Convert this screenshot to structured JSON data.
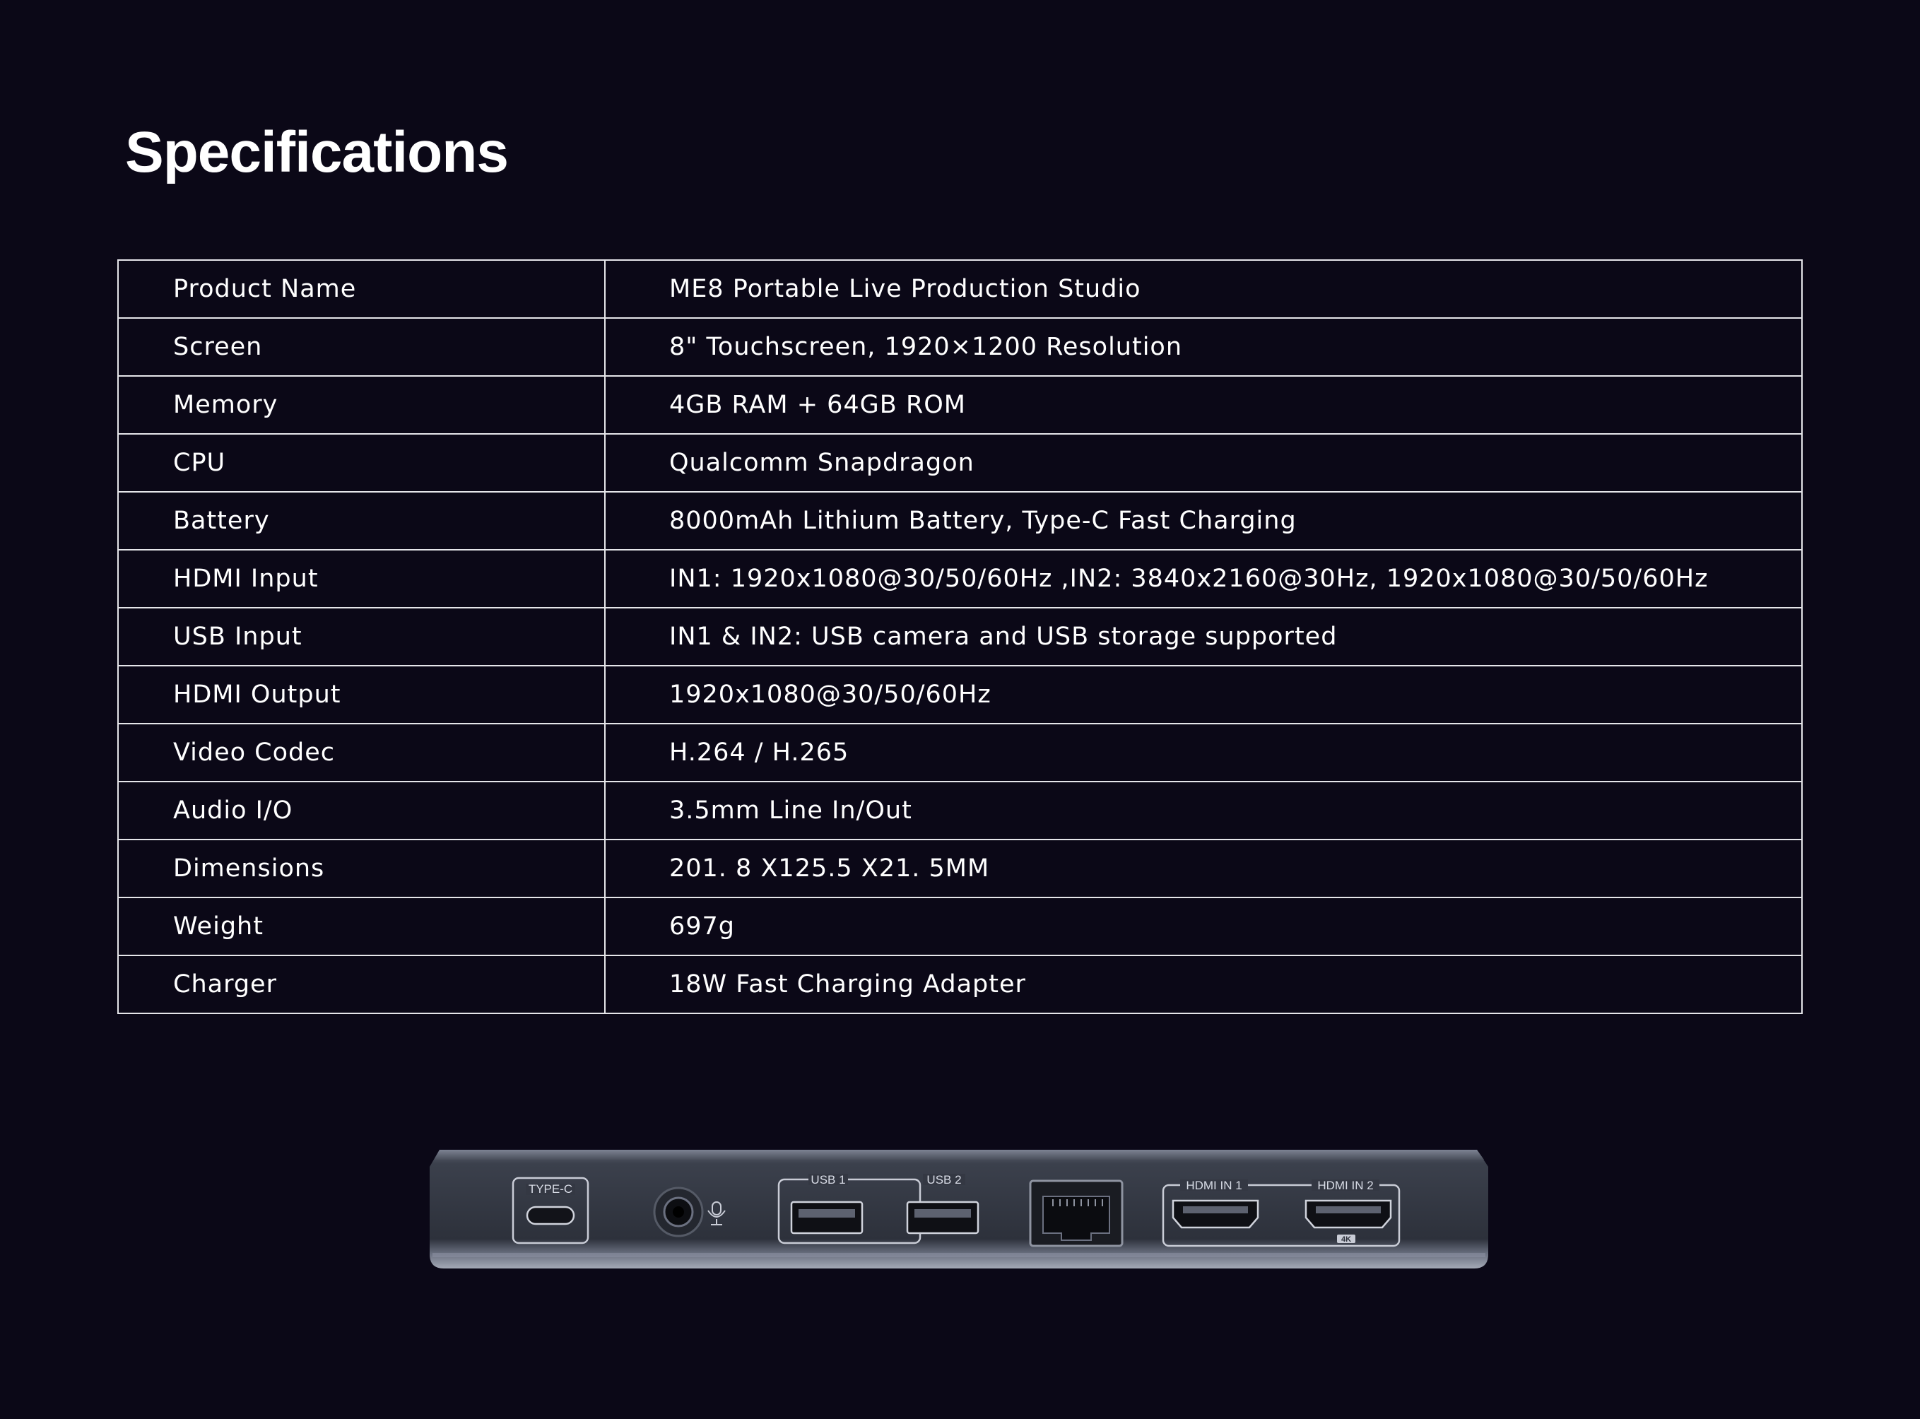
{
  "page": {
    "title": "Specifications"
  },
  "specs": [
    {
      "label": "Product Name",
      "value": "ME8 Portable Live Production Studio"
    },
    {
      "label": "Screen",
      "value": "8\" Touchscreen, 1920×1200 Resolution"
    },
    {
      "label": "Memory",
      "value": "4GB RAM + 64GB ROM"
    },
    {
      "label": "CPU",
      "value": "Qualcomm Snapdragon"
    },
    {
      "label": "Battery",
      "value": "8000mAh Lithium Battery, Type-C Fast Charging"
    },
    {
      "label": "HDMI Input",
      "value": "IN1: 1920x1080@30/50/60Hz ,IN2: 3840x2160@30Hz, 1920x1080@30/50/60Hz"
    },
    {
      "label": "USB Input",
      "value": "IN1 & IN2: USB camera and USB storage supported"
    },
    {
      "label": "HDMI Output",
      "value": "1920x1080@30/50/60Hz"
    },
    {
      "label": "Video Codec",
      "value": "H.264 / H.265"
    },
    {
      "label": "Audio I/O",
      "value": "3.5mm Line In/Out"
    },
    {
      "label": "Dimensions",
      "value": "201. 8 X125.5 X21. 5MM"
    },
    {
      "label": "Weight",
      "value": "697g"
    },
    {
      "label": "Charger",
      "value": "18W Fast Charging Adapter"
    }
  ],
  "device": {
    "ports": {
      "type_c": "TYPE-C",
      "usb1": "USB 1",
      "usb2": "USB 2",
      "hdmi_in1": "HDMI IN 1",
      "hdmi_in2": "HDMI IN 2",
      "badge_4k": "4K"
    },
    "icons": {
      "audio_jack": "audio-jack-icon",
      "mic": "mic-icon",
      "ethernet": "ethernet-port-icon"
    }
  },
  "colors": {
    "background": "#0b0817",
    "text": "#ffffff",
    "table_border": "#e6e6ea",
    "device_body": "#3a3f4c",
    "port_outline": "#c9ccd6"
  }
}
